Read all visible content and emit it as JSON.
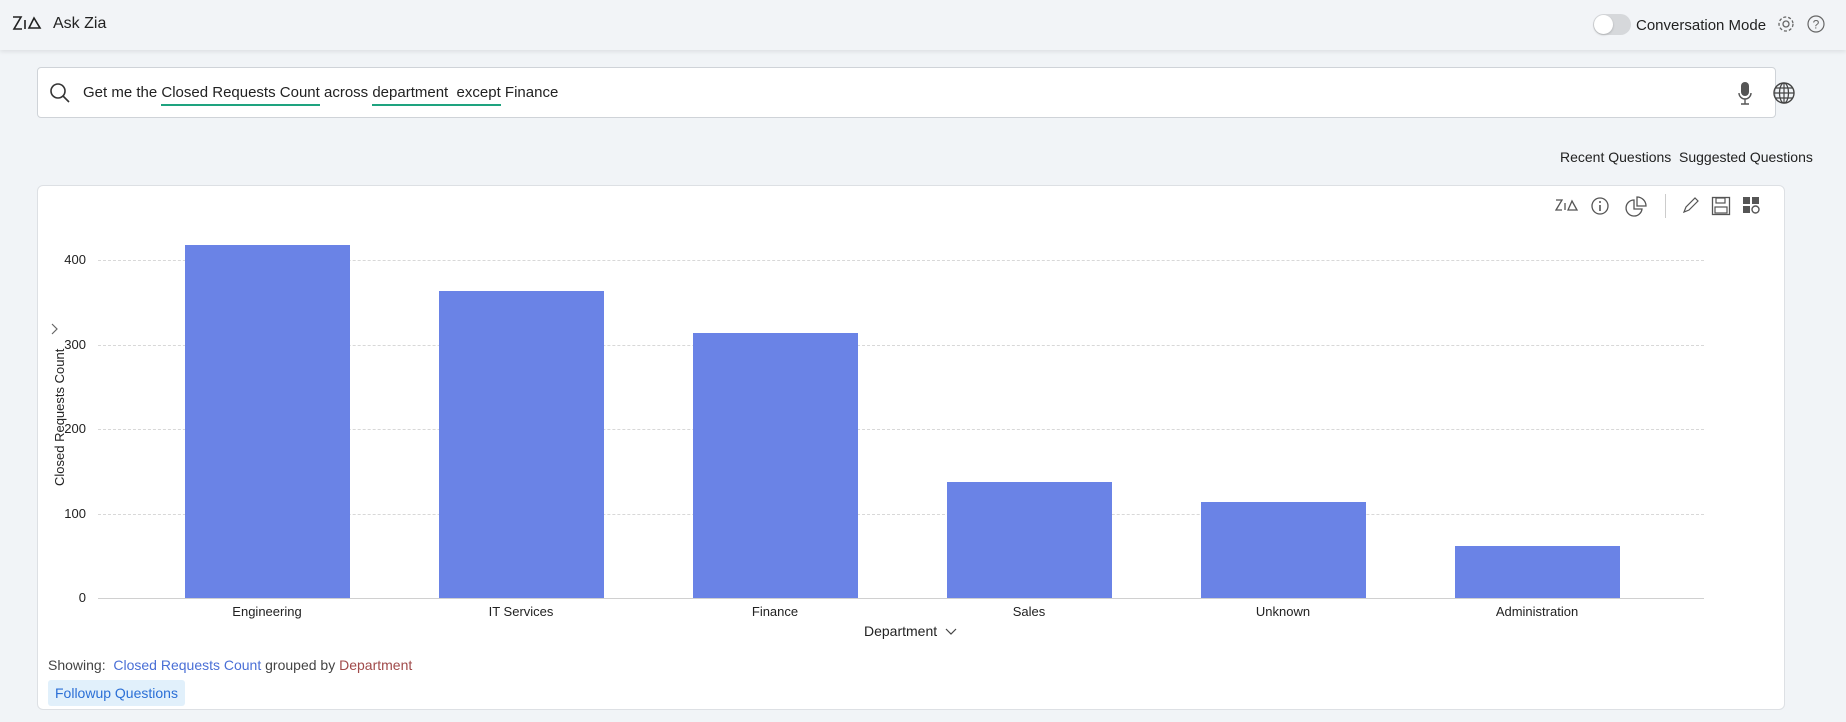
{
  "header": {
    "title": "Ask Zia",
    "conversation_mode_label": "Conversation Mode",
    "conversation_mode_on": false
  },
  "search": {
    "parts": [
      "Get me the ",
      "Closed Requests Count",
      " across ",
      "department  except",
      " Finance"
    ]
  },
  "links": {
    "recent": "Recent Questions",
    "suggested": "Suggested Questions"
  },
  "chart_data": {
    "type": "bar",
    "categories": [
      "Engineering",
      "IT Services",
      "Finance",
      "Sales",
      "Unknown",
      "Administration"
    ],
    "values": [
      418,
      364,
      314,
      138,
      114,
      62
    ],
    "xlabel": "Department",
    "ylabel": "Closed Requests Count",
    "ylim": [
      0,
      400
    ],
    "yticks": [
      "0",
      "100",
      "200",
      "300",
      "400"
    ],
    "grid": true,
    "bar_color": "#6a83e6"
  },
  "footer": {
    "showing_label": "Showing:",
    "measure": "Closed Requests Count",
    "grouped_by": "grouped by",
    "dimension": "Department",
    "followup": "Followup Questions"
  }
}
